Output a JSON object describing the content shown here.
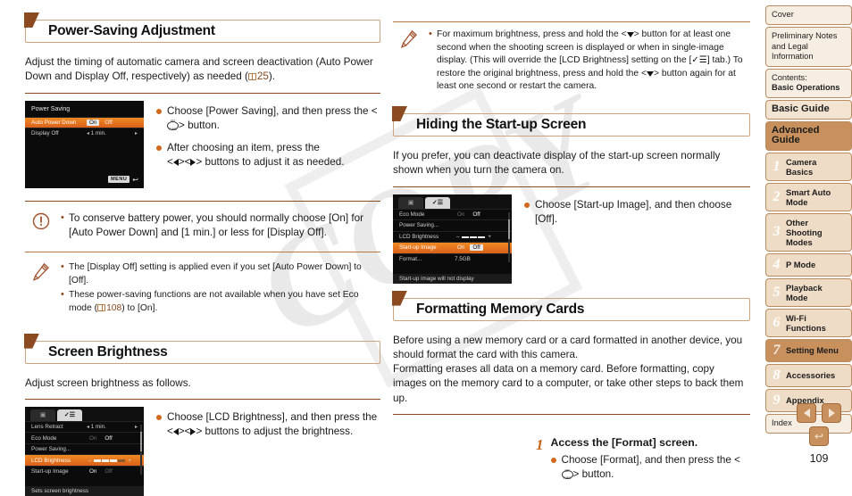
{
  "watermark": {
    "text": "COPY"
  },
  "page": {
    "number": "109"
  },
  "left_column": {
    "section1": {
      "heading": "Power-Saving Adjustment",
      "intro_prefix": "Adjust the timing of automatic camera and screen deactivation (Auto Power Down and Display Off, respectively) as needed (",
      "intro_ref": "25",
      "intro_suffix": ").",
      "screen": {
        "title": "Power Saving",
        "rows": [
          {
            "label": "Auto Power Down",
            "value_on": "On",
            "value_off": "Off",
            "selected": true
          },
          {
            "label": "Display Off",
            "value": "1 min.",
            "selected": false
          }
        ],
        "menu_badge": "MENU"
      },
      "bullets": [
        "Choose [Power Saving], and then press the < > button.",
        "After choosing an item, press the < >< > buttons to adjust it as needed."
      ]
    },
    "caution": {
      "icon": "exclamation-icon",
      "items": [
        "To conserve battery power, you should normally choose [On] for [Auto Power Down] and [1 min.] or less for [Display Off]."
      ]
    },
    "note": {
      "icon": "pencil-icon",
      "items": [
        "The [Display Off] setting is applied even if you set [Auto Power Down] to [Off].",
        "These power-saving functions are not available when you have set Eco mode (  108) to [On]."
      ],
      "item2_prefix": "These power-saving functions are not available when you have set Eco mode (",
      "item2_ref": "108",
      "item2_suffix": ") to [On]."
    },
    "section2": {
      "heading": "Screen Brightness",
      "intro": "Adjust screen brightness as follows.",
      "screen": {
        "tab_camera": "camera-tab-icon",
        "tab_wrench": "wrench-tab-icon",
        "rows": [
          {
            "label": "Lens Retract",
            "value": "1 min."
          },
          {
            "label": "Eco Mode",
            "value_on": "On",
            "value_off": "Off"
          },
          {
            "label": "Power Saving..."
          },
          {
            "label": "LCD Brightness",
            "value": "slider",
            "selected": true
          },
          {
            "label": "Start-up Image",
            "value_on": "On",
            "value_off": "Off"
          }
        ],
        "footer": "Sets screen brightness"
      },
      "bullets": [
        "Choose [LCD Brightness], and then press the < >< > buttons to adjust the brightness."
      ]
    }
  },
  "right_column": {
    "note": {
      "icon": "pencil-icon",
      "items": [
        "For maximum brightness, press and hold the < > button for at least one second when the shooting screen is displayed or when in single-image display. (This will override the [LCD Brightness] setting on the [  ] tab.) To restore the original brightness, press and hold the < > button again for at least one second or restart the camera."
      ]
    },
    "section3": {
      "heading": "Hiding the Start-up Screen",
      "intro": "If you prefer, you can deactivate display of the start-up screen normally shown when you turn the camera on.",
      "screen": {
        "rows": [
          {
            "label": "Eco Mode",
            "value_on": "On",
            "value_off": "Off"
          },
          {
            "label": "Power Saving..."
          },
          {
            "label": "LCD Brightness",
            "value": "slider"
          },
          {
            "label": "Start-up Image",
            "value_on": "On",
            "value_off": "Off",
            "selected": true
          },
          {
            "label": "Format...",
            "value": "7.5GB"
          }
        ],
        "footer": "Start-up image will not display"
      },
      "bullets": [
        "Choose [Start-up Image], and then choose [Off]."
      ]
    },
    "section4": {
      "heading": "Formatting Memory Cards",
      "intro_p1": "Before using a new memory card or a card formatted in another device, you should format the card with this camera.",
      "intro_p2": "Formatting erases all data on a memory card. Before formatting, copy images on the memory card to a computer, or take other steps to back them up.",
      "step": {
        "number": "1",
        "title": "Access the [Format] screen.",
        "bullet": "Choose [Format], and then press the < > button."
      }
    }
  },
  "sidebar": {
    "items": [
      {
        "type": "plain",
        "label": "Cover",
        "name": "cover"
      },
      {
        "type": "plain",
        "label": "Preliminary Notes and Legal Information",
        "name": "preliminary-notes"
      },
      {
        "type": "plain",
        "label": "Contents:\nBasic Operations",
        "line1": "Contents:",
        "line2": "Basic Operations",
        "name": "contents"
      },
      {
        "type": "big",
        "label": "Basic Guide",
        "name": "basic-guide"
      },
      {
        "type": "current",
        "label": "Advanced Guide",
        "name": "advanced-guide"
      },
      {
        "type": "chapter",
        "num": "1",
        "label": "Camera Basics",
        "name": "camera-basics",
        "active": false
      },
      {
        "type": "chapter",
        "num": "2",
        "label": "Smart Auto Mode",
        "name": "smart-auto-mode",
        "active": false
      },
      {
        "type": "chapter",
        "num": "3",
        "label": "Other Shooting Modes",
        "name": "other-shooting-modes",
        "active": false
      },
      {
        "type": "chapter",
        "num": "4",
        "label": "P Mode",
        "name": "p-mode",
        "active": false
      },
      {
        "type": "chapter",
        "num": "5",
        "label": "Playback Mode",
        "name": "playback-mode",
        "active": false
      },
      {
        "type": "chapter",
        "num": "6",
        "label": "Wi-Fi Functions",
        "name": "wifi-functions",
        "active": false
      },
      {
        "type": "chapter",
        "num": "7",
        "label": "Setting Menu",
        "name": "setting-menu",
        "active": true
      },
      {
        "type": "chapter",
        "num": "8",
        "label": "Accessories",
        "name": "accessories",
        "active": false
      },
      {
        "type": "chapter",
        "num": "9",
        "label": "Appendix",
        "name": "appendix",
        "active": false
      },
      {
        "type": "plain",
        "label": "Index",
        "name": "index"
      }
    ]
  },
  "pagenav": {
    "prev": "prev-page-arrow",
    "next": "next-page-arrow",
    "back": "back-button"
  },
  "colors": {
    "accent_brown": "#8c4a21",
    "heading_border": "#c9a47e",
    "bullet_dot": "#d2691e",
    "sidebar_active": "#c8905c",
    "sidebar_bg": "#f3e6d8",
    "camera_highlight": "#e87722"
  }
}
